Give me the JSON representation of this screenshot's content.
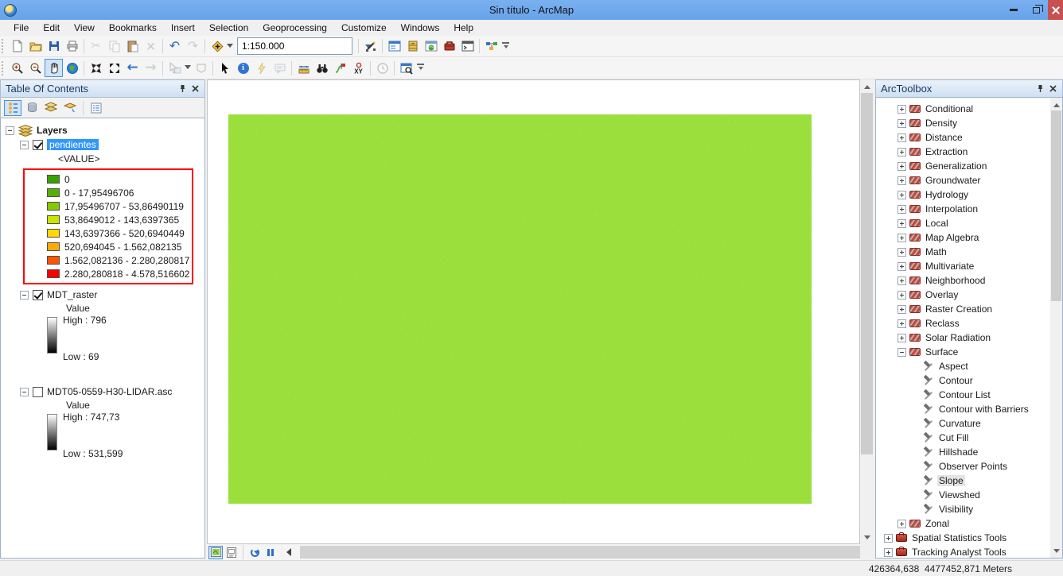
{
  "window": {
    "title": "Sin título - ArcMap"
  },
  "menu": {
    "items": [
      "File",
      "Edit",
      "View",
      "Bookmarks",
      "Insert",
      "Selection",
      "Geoprocessing",
      "Customize",
      "Windows",
      "Help"
    ]
  },
  "standard_toolbar": {
    "scale_value": "1:150.000"
  },
  "colors": {
    "titlebar": "#67a3ea",
    "selection_highlight": "#2f97fd",
    "legend_outline": "#ff0000"
  },
  "toc": {
    "title": "Table Of Contents",
    "root_label": "Layers",
    "layer_pendientes": {
      "name": "pendientes",
      "field": "<VALUE>",
      "legend": [
        {
          "color": "#38a300",
          "label": "0"
        },
        {
          "color": "#56b000",
          "label": "0 - 17,95496706"
        },
        {
          "color": "#85c900",
          "label": "17,95496707 - 53,86490119"
        },
        {
          "color": "#c9e400",
          "label": "53,8649012 - 143,6397365"
        },
        {
          "color": "#ffd900",
          "label": "143,6397366 - 520,6940449"
        },
        {
          "color": "#ffaa00",
          "label": "520,694045 - 1.562,082135"
        },
        {
          "color": "#ff5500",
          "label": "1.562,082136 - 2.280,280817"
        },
        {
          "color": "#ff0000",
          "label": "2.280,280818 - 4.578,516602"
        }
      ]
    },
    "layer_mdt": {
      "name": "MDT_raster",
      "value_label": "Value",
      "high": "High : 796",
      "low": "Low : 69"
    },
    "layer_lidar": {
      "name": "MDT05-0559-H30-LIDAR.asc",
      "value_label": "Value",
      "high": "High : 747,73",
      "low": "Low : 531,599"
    }
  },
  "arctoolbox": {
    "title": "ArcToolbox",
    "items": [
      {
        "label": "Conditional",
        "icon": "toolset",
        "exp": "collapsed",
        "indent": 1
      },
      {
        "label": "Density",
        "icon": "toolset",
        "exp": "collapsed",
        "indent": 1
      },
      {
        "label": "Distance",
        "icon": "toolset",
        "exp": "collapsed",
        "indent": 1
      },
      {
        "label": "Extraction",
        "icon": "toolset",
        "exp": "collapsed",
        "indent": 1
      },
      {
        "label": "Generalization",
        "icon": "toolset",
        "exp": "collapsed",
        "indent": 1
      },
      {
        "label": "Groundwater",
        "icon": "toolset",
        "exp": "collapsed",
        "indent": 1
      },
      {
        "label": "Hydrology",
        "icon": "toolset",
        "exp": "collapsed",
        "indent": 1
      },
      {
        "label": "Interpolation",
        "icon": "toolset",
        "exp": "collapsed",
        "indent": 1
      },
      {
        "label": "Local",
        "icon": "toolset",
        "exp": "collapsed",
        "indent": 1
      },
      {
        "label": "Map Algebra",
        "icon": "toolset",
        "exp": "collapsed",
        "indent": 1
      },
      {
        "label": "Math",
        "icon": "toolset",
        "exp": "collapsed",
        "indent": 1
      },
      {
        "label": "Multivariate",
        "icon": "toolset",
        "exp": "collapsed",
        "indent": 1
      },
      {
        "label": "Neighborhood",
        "icon": "toolset",
        "exp": "collapsed",
        "indent": 1
      },
      {
        "label": "Overlay",
        "icon": "toolset",
        "exp": "collapsed",
        "indent": 1
      },
      {
        "label": "Raster Creation",
        "icon": "toolset",
        "exp": "collapsed",
        "indent": 1
      },
      {
        "label": "Reclass",
        "icon": "toolset",
        "exp": "collapsed",
        "indent": 1
      },
      {
        "label": "Solar Radiation",
        "icon": "toolset",
        "exp": "collapsed",
        "indent": 1
      },
      {
        "label": "Surface",
        "icon": "toolset",
        "exp": "expanded",
        "indent": 1
      },
      {
        "label": "Aspect",
        "icon": "tool",
        "exp": "leaf",
        "indent": 2
      },
      {
        "label": "Contour",
        "icon": "tool",
        "exp": "leaf",
        "indent": 2
      },
      {
        "label": "Contour List",
        "icon": "tool",
        "exp": "leaf",
        "indent": 2
      },
      {
        "label": "Contour with Barriers",
        "icon": "tool",
        "exp": "leaf",
        "indent": 2
      },
      {
        "label": "Curvature",
        "icon": "tool",
        "exp": "leaf",
        "indent": 2
      },
      {
        "label": "Cut Fill",
        "icon": "tool",
        "exp": "leaf",
        "indent": 2
      },
      {
        "label": "Hillshade",
        "icon": "tool",
        "exp": "leaf",
        "indent": 2
      },
      {
        "label": "Observer Points",
        "icon": "tool",
        "exp": "leaf",
        "indent": 2
      },
      {
        "label": "Slope",
        "icon": "tool",
        "exp": "leaf",
        "indent": 2,
        "selected": "true"
      },
      {
        "label": "Viewshed",
        "icon": "tool",
        "exp": "leaf",
        "indent": 2
      },
      {
        "label": "Visibility",
        "icon": "tool",
        "exp": "leaf",
        "indent": 2
      },
      {
        "label": "Zonal",
        "icon": "toolset",
        "exp": "collapsed",
        "indent": 1
      },
      {
        "label": "Spatial Statistics Tools",
        "icon": "toolbox",
        "exp": "collapsed",
        "indent": 0
      },
      {
        "label": "Tracking Analyst Tools",
        "icon": "toolbox",
        "exp": "collapsed",
        "indent": 0
      }
    ]
  },
  "statusbar": {
    "coordinates": "426364,638  4477452,871 Meters"
  }
}
